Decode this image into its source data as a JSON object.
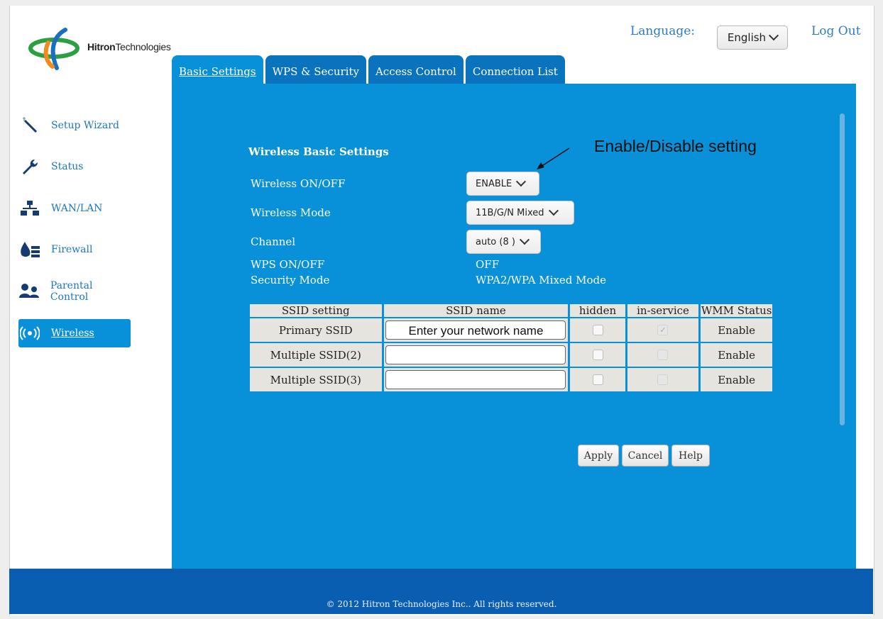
{
  "brand": {
    "logo_text_bold": "Hitron",
    "logo_text_rest": "Technologies"
  },
  "header": {
    "language_label": "Language:",
    "language_value": "English",
    "logout_label": "Log Out"
  },
  "tabs": [
    {
      "label": "Basic Settings",
      "active": true
    },
    {
      "label": "WPS & Security",
      "active": false
    },
    {
      "label": "Access Control",
      "active": false
    },
    {
      "label": "Connection List",
      "active": false
    }
  ],
  "sidebar": {
    "items": [
      {
        "label": "Setup Wizard",
        "icon": "wand-icon"
      },
      {
        "label": "Status",
        "icon": "wrench-icon"
      },
      {
        "label": "WAN/LAN",
        "icon": "network-icon"
      },
      {
        "label": "Firewall",
        "icon": "firewall-icon"
      },
      {
        "label": "Parental Control",
        "icon": "users-icon"
      },
      {
        "label": "Wireless",
        "icon": "wireless-icon",
        "active": true
      }
    ]
  },
  "main": {
    "section_title": "Wireless Basic Settings",
    "annotation": "Enable/Disable setting",
    "wireless_onoff": {
      "label": "Wireless ON/OFF",
      "value": "ENABLE"
    },
    "wireless_mode": {
      "label": "Wireless Mode",
      "value": "11B/G/N Mixed"
    },
    "channel": {
      "label": "Channel",
      "value": "auto (8 )"
    },
    "wps_onoff": {
      "label": "WPS ON/OFF",
      "value": "OFF"
    },
    "security_mode": {
      "label": "Security Mode",
      "value": "WPA2/WPA Mixed Mode"
    },
    "table": {
      "headers": [
        "SSID setting",
        "SSID name",
        "hidden",
        "in-service",
        "WMM Status"
      ],
      "rows": [
        {
          "setting": "Primary SSID",
          "name": "Enter your network name",
          "hidden": false,
          "in_service": true,
          "wmm": "Enable"
        },
        {
          "setting": "Multiple SSID(2)",
          "name": "",
          "hidden": false,
          "in_service": false,
          "wmm": "Enable"
        },
        {
          "setting": "Multiple SSID(3)",
          "name": "",
          "hidden": false,
          "in_service": false,
          "wmm": "Enable"
        }
      ]
    },
    "buttons": {
      "apply": "Apply",
      "cancel": "Cancel",
      "help": "Help"
    }
  },
  "footer": {
    "copyright": "© 2012 Hitron Technologies Inc.. All rights reserved."
  },
  "colors": {
    "panel": "#0890d8",
    "tab": "#0a73bd",
    "footer": "#0a5eb1",
    "link": "#2f7bc6"
  }
}
